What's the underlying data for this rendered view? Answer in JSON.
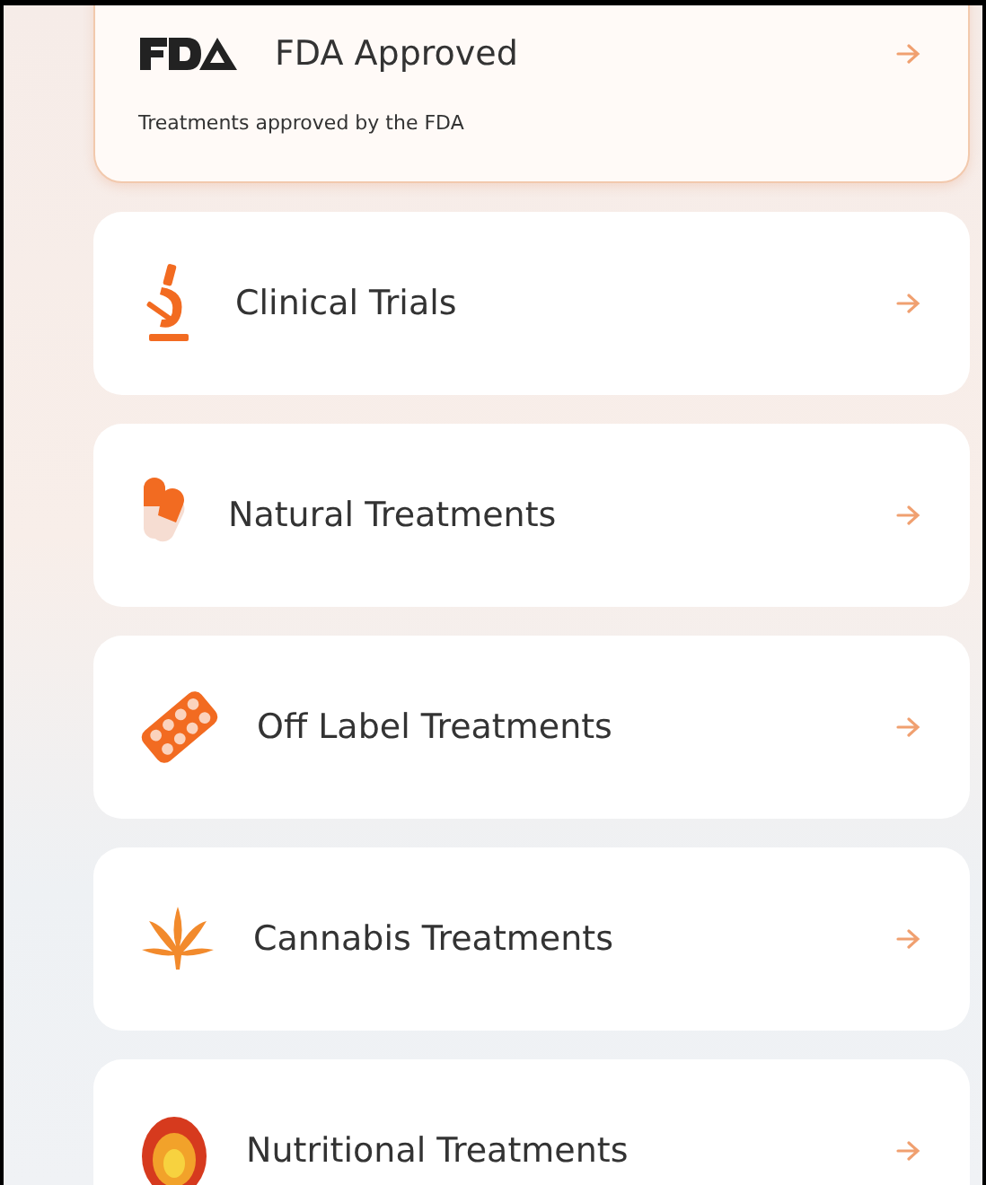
{
  "categories": [
    {
      "title": "FDA Approved",
      "description": "Treatments approved by the FDA",
      "selected": true
    },
    {
      "title": "Clinical Trials",
      "selected": false
    },
    {
      "title": "Natural Treatments",
      "selected": false
    },
    {
      "title": "Off Label Treatments",
      "selected": false
    },
    {
      "title": "Cannabis Treatments",
      "selected": false
    },
    {
      "title": "Nutritional Treatments",
      "selected": false
    }
  ]
}
